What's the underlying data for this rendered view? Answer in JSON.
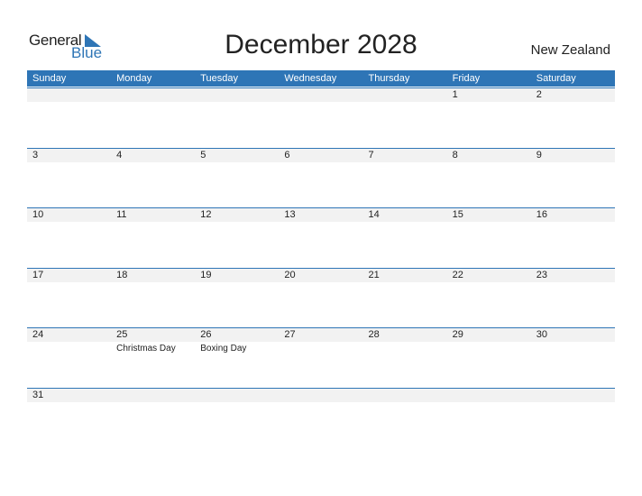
{
  "logo": {
    "word1": "General",
    "word2": "Blue"
  },
  "title": "December 2028",
  "country": "New Zealand",
  "colors": {
    "accent": "#2e75b6",
    "strip": "#f2f2f2"
  },
  "weekdays": [
    "Sunday",
    "Monday",
    "Tuesday",
    "Wednesday",
    "Thursday",
    "Friday",
    "Saturday"
  ],
  "weeks": [
    {
      "days": [
        "",
        "",
        "",
        "",
        "",
        "1",
        "2"
      ],
      "holidays": [
        "",
        "",
        "",
        "",
        "",
        "",
        ""
      ]
    },
    {
      "days": [
        "3",
        "4",
        "5",
        "6",
        "7",
        "8",
        "9"
      ],
      "holidays": [
        "",
        "",
        "",
        "",
        "",
        "",
        ""
      ]
    },
    {
      "days": [
        "10",
        "11",
        "12",
        "13",
        "14",
        "15",
        "16"
      ],
      "holidays": [
        "",
        "",
        "",
        "",
        "",
        "",
        ""
      ]
    },
    {
      "days": [
        "17",
        "18",
        "19",
        "20",
        "21",
        "22",
        "23"
      ],
      "holidays": [
        "",
        "",
        "",
        "",
        "",
        "",
        ""
      ]
    },
    {
      "days": [
        "24",
        "25",
        "26",
        "27",
        "28",
        "29",
        "30"
      ],
      "holidays": [
        "",
        "Christmas Day",
        "Boxing Day",
        "",
        "",
        "",
        ""
      ]
    },
    {
      "days": [
        "31",
        "",
        "",
        "",
        "",
        "",
        ""
      ],
      "holidays": [
        "",
        "",
        "",
        "",
        "",
        "",
        ""
      ]
    }
  ]
}
